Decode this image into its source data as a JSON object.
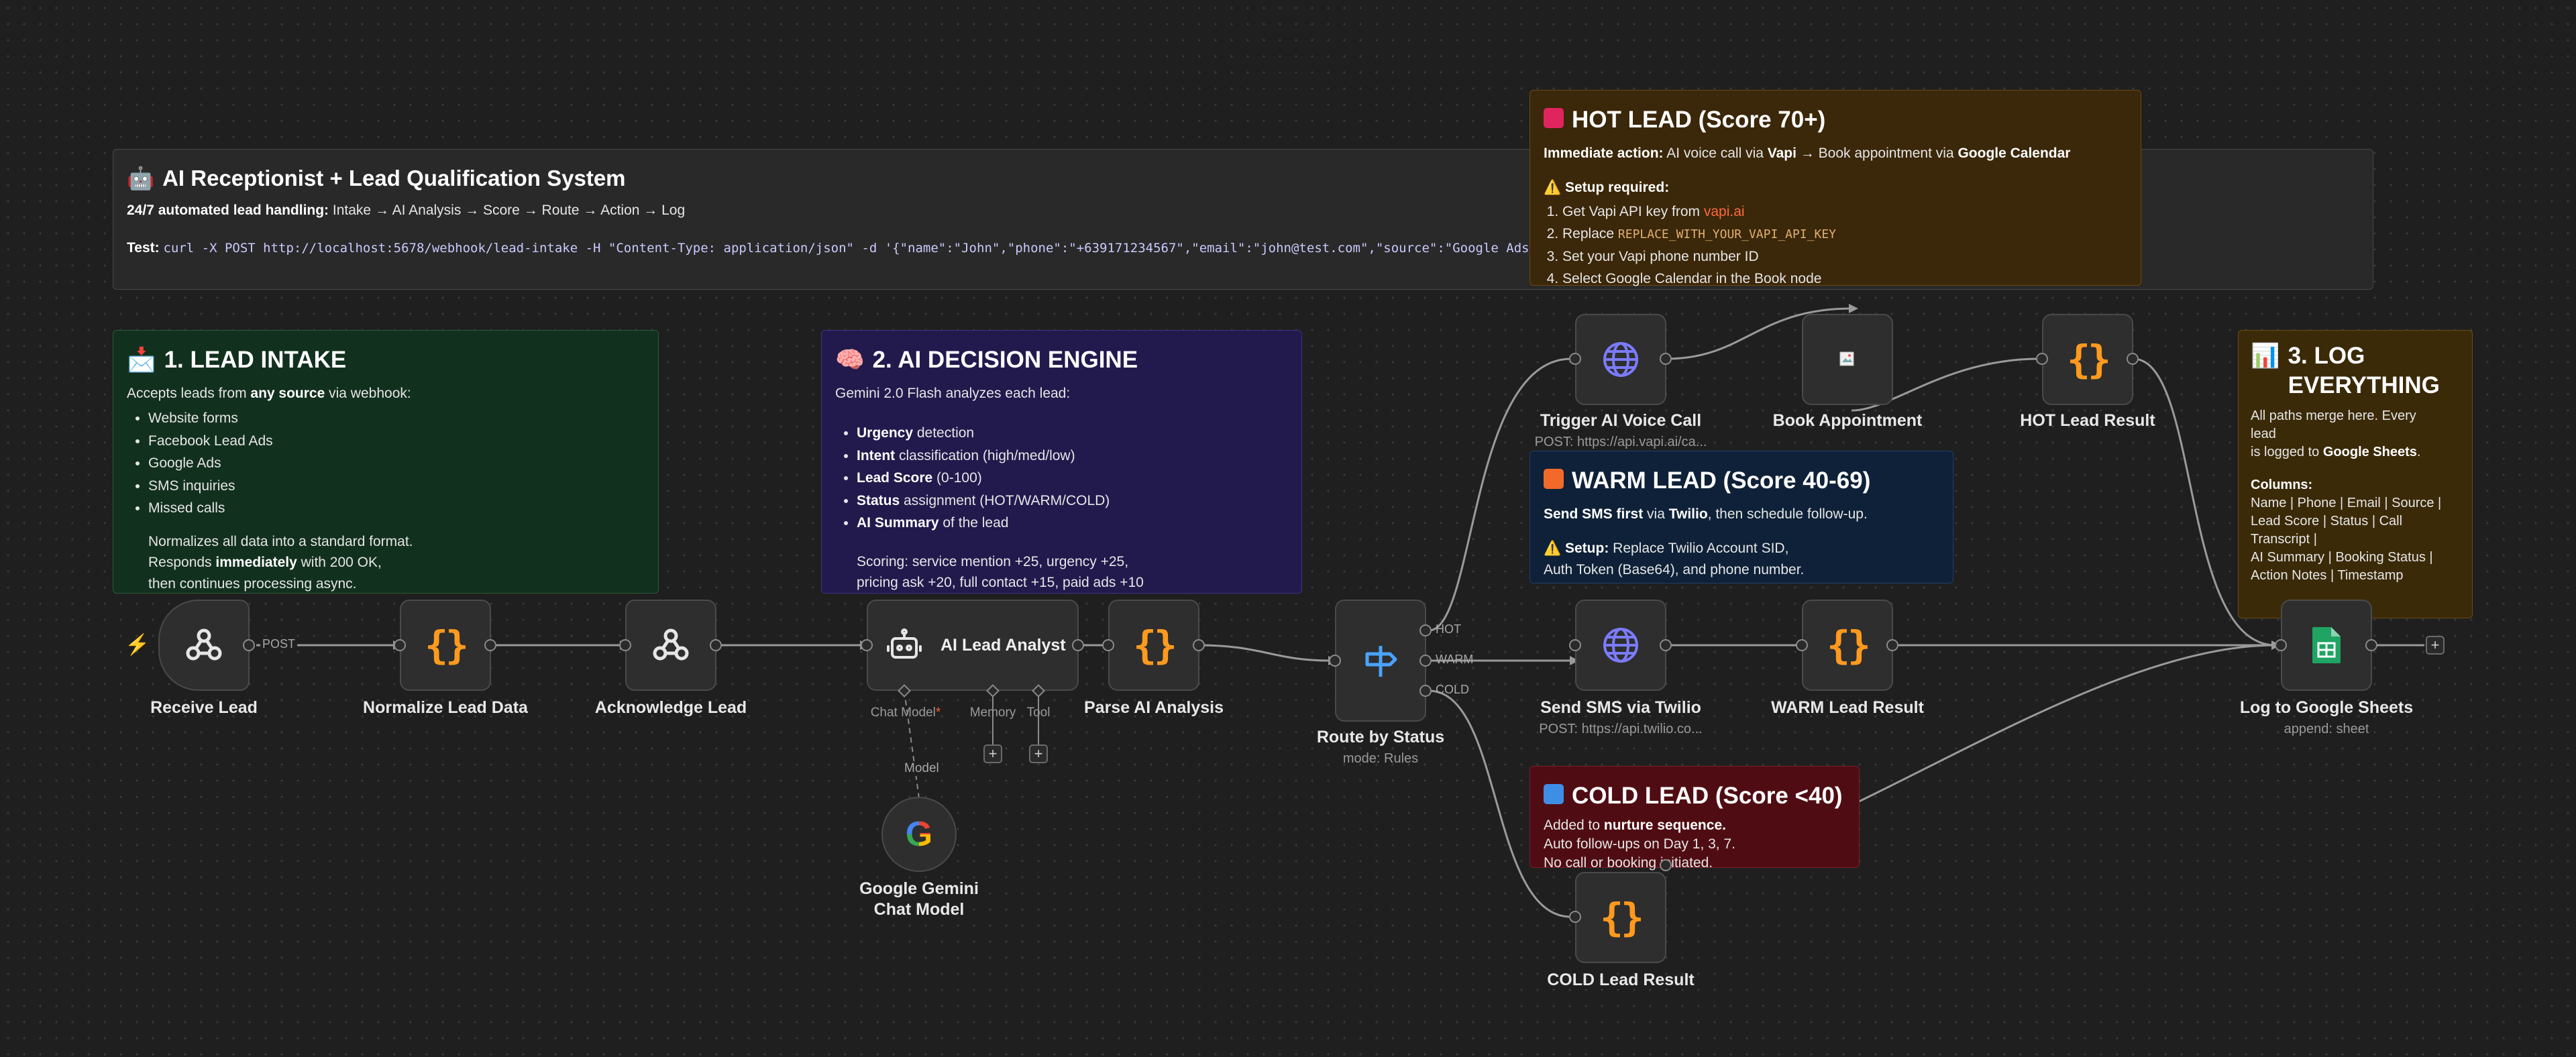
{
  "colors": {
    "canvas": "#1f1f1f",
    "edge": "#9a9a9a",
    "code_icon": "#ff9a1f",
    "globe_icon": "#6d6cf4",
    "link": "#ff6a3d"
  },
  "header_note": {
    "icon": "robot-emoji",
    "title": "AI Receptionist + Lead Qualification System",
    "subtitle_bold": "24/7 automated lead handling:",
    "subtitle_rest": " Intake → AI Analysis → Score → Route → Action → Log",
    "test_label": "Test:",
    "test_cmd": "curl -X POST http://localhost:5678/webhook/lead-intake -H \"Content-Type: application/json\" -d '{\"name\":\"John\",\"phone\":\"+639171234567\",\"email\":\"john@test.com\",\"source\":\"Google Ads"
  },
  "intake_note": {
    "icon": "inbox-emoji",
    "title": "1. LEAD INTAKE",
    "intro_a": "Accepts leads from ",
    "intro_b": "any source",
    "intro_c": " via webhook:",
    "items": [
      "Website forms",
      "Facebook Lead Ads",
      "Google Ads",
      "SMS inquiries",
      "Missed calls"
    ],
    "line1": "Normalizes all data into a standard format.",
    "line2_a": "Responds ",
    "line2_b": "immediately",
    "line2_c": " with 200 OK,",
    "line3": "then continues processing async."
  },
  "ai_note": {
    "icon": "brain-emoji",
    "title": "2. AI DECISION ENGINE",
    "intro": "Gemini 2.0 Flash analyzes each lead:",
    "items": [
      {
        "b": "Urgency",
        "t": " detection"
      },
      {
        "b": "Intent",
        "t": " classification (high/med/low)"
      },
      {
        "b": "Lead Score",
        "t": " (0-100)"
      },
      {
        "b": "Status",
        "t": " assignment (HOT/WARM/COLD)"
      },
      {
        "b": "AI Summary",
        "t": " of the lead"
      }
    ],
    "scoring1": "Scoring: service mention +25, urgency +25,",
    "scoring2": "pricing ask +20, full contact +15, paid ads +10"
  },
  "hot_note": {
    "title": "HOT LEAD (Score 70+)",
    "action_b": "Immediate action:",
    "action_t1": " AI voice call via ",
    "action_vapi": "Vapi",
    "action_t2": " → Book appointment via ",
    "action_gc": "Google Calendar",
    "setup": "Setup required:",
    "step1_a": "Get Vapi API key from ",
    "step1_link": "vapi.ai",
    "step2_a": "Replace ",
    "step2_code": "REPLACE_WITH_YOUR_VAPI_API_KEY",
    "step3": "Set your Vapi phone number ID",
    "step4": "Select Google Calendar in the Book node"
  },
  "warm_note": {
    "title": "WARM LEAD (Score 40-69)",
    "line1_b": "Send SMS first",
    "line1_t1": " via ",
    "line1_tw": "Twilio",
    "line1_t2": ", then schedule follow-up.",
    "setup_b": "Setup:",
    "setup_t": " Replace Twilio Account SID,",
    "line3": "Auth Token (Base64), and phone number."
  },
  "cold_note": {
    "title": "COLD LEAD (Score <40)",
    "line1_a": "Added to ",
    "line1_b": "nurture sequence.",
    "line2": "Auto follow-ups on Day 1, 3, 7.",
    "line3": "No call or booking initiated."
  },
  "log_note": {
    "icon": "bar-chart-emoji",
    "title1": "3. LOG",
    "title2": "EVERYTHING",
    "line1": "All paths merge here. Every",
    "line2": "lead",
    "line3_a": "is logged to ",
    "line3_b": "Google Sheets",
    "line3_c": ".",
    "columns": "Columns:",
    "c1": "Name | Phone | Email | Source |",
    "c2": "Lead Score | Status | Call",
    "c3": "Transcript |",
    "c4": "AI Summary | Booking Status |",
    "c5": "Action Notes | Timestamp"
  },
  "nodes": {
    "receive_lead": {
      "label": "Receive Lead"
    },
    "normalize": {
      "label": "Normalize Lead Data"
    },
    "acknowledge": {
      "label": "Acknowledge Lead"
    },
    "ai_analyst": {
      "label": "AI Lead Analyst",
      "sub_chat": "Chat Model",
      "sub_chat_req": "*",
      "sub_memory": "Memory",
      "sub_tool": "Tool",
      "model_edge": "Model"
    },
    "gemini": {
      "label1": "Google Gemini",
      "label2": "Chat Model"
    },
    "parse": {
      "label": "Parse AI Analysis"
    },
    "route": {
      "label": "Route by Status",
      "sub": "mode: Rules",
      "out_hot": "HOT",
      "out_warm": "WARM",
      "out_cold": "COLD"
    },
    "voice_call": {
      "label": "Trigger AI Voice Call",
      "sub": "POST: https://api.vapi.ai/ca..."
    },
    "book": {
      "label": "Book Appointment"
    },
    "hot_result": {
      "label": "HOT Lead Result"
    },
    "sms": {
      "label": "Send SMS via Twilio",
      "sub": "POST: https://api.twilio.co..."
    },
    "warm_result": {
      "label": "WARM Lead Result"
    },
    "cold_result": {
      "label": "COLD Lead Result"
    },
    "sheets": {
      "label": "Log to Google Sheets",
      "sub": "append: sheet"
    }
  },
  "edge_labels": {
    "post": "POST"
  }
}
